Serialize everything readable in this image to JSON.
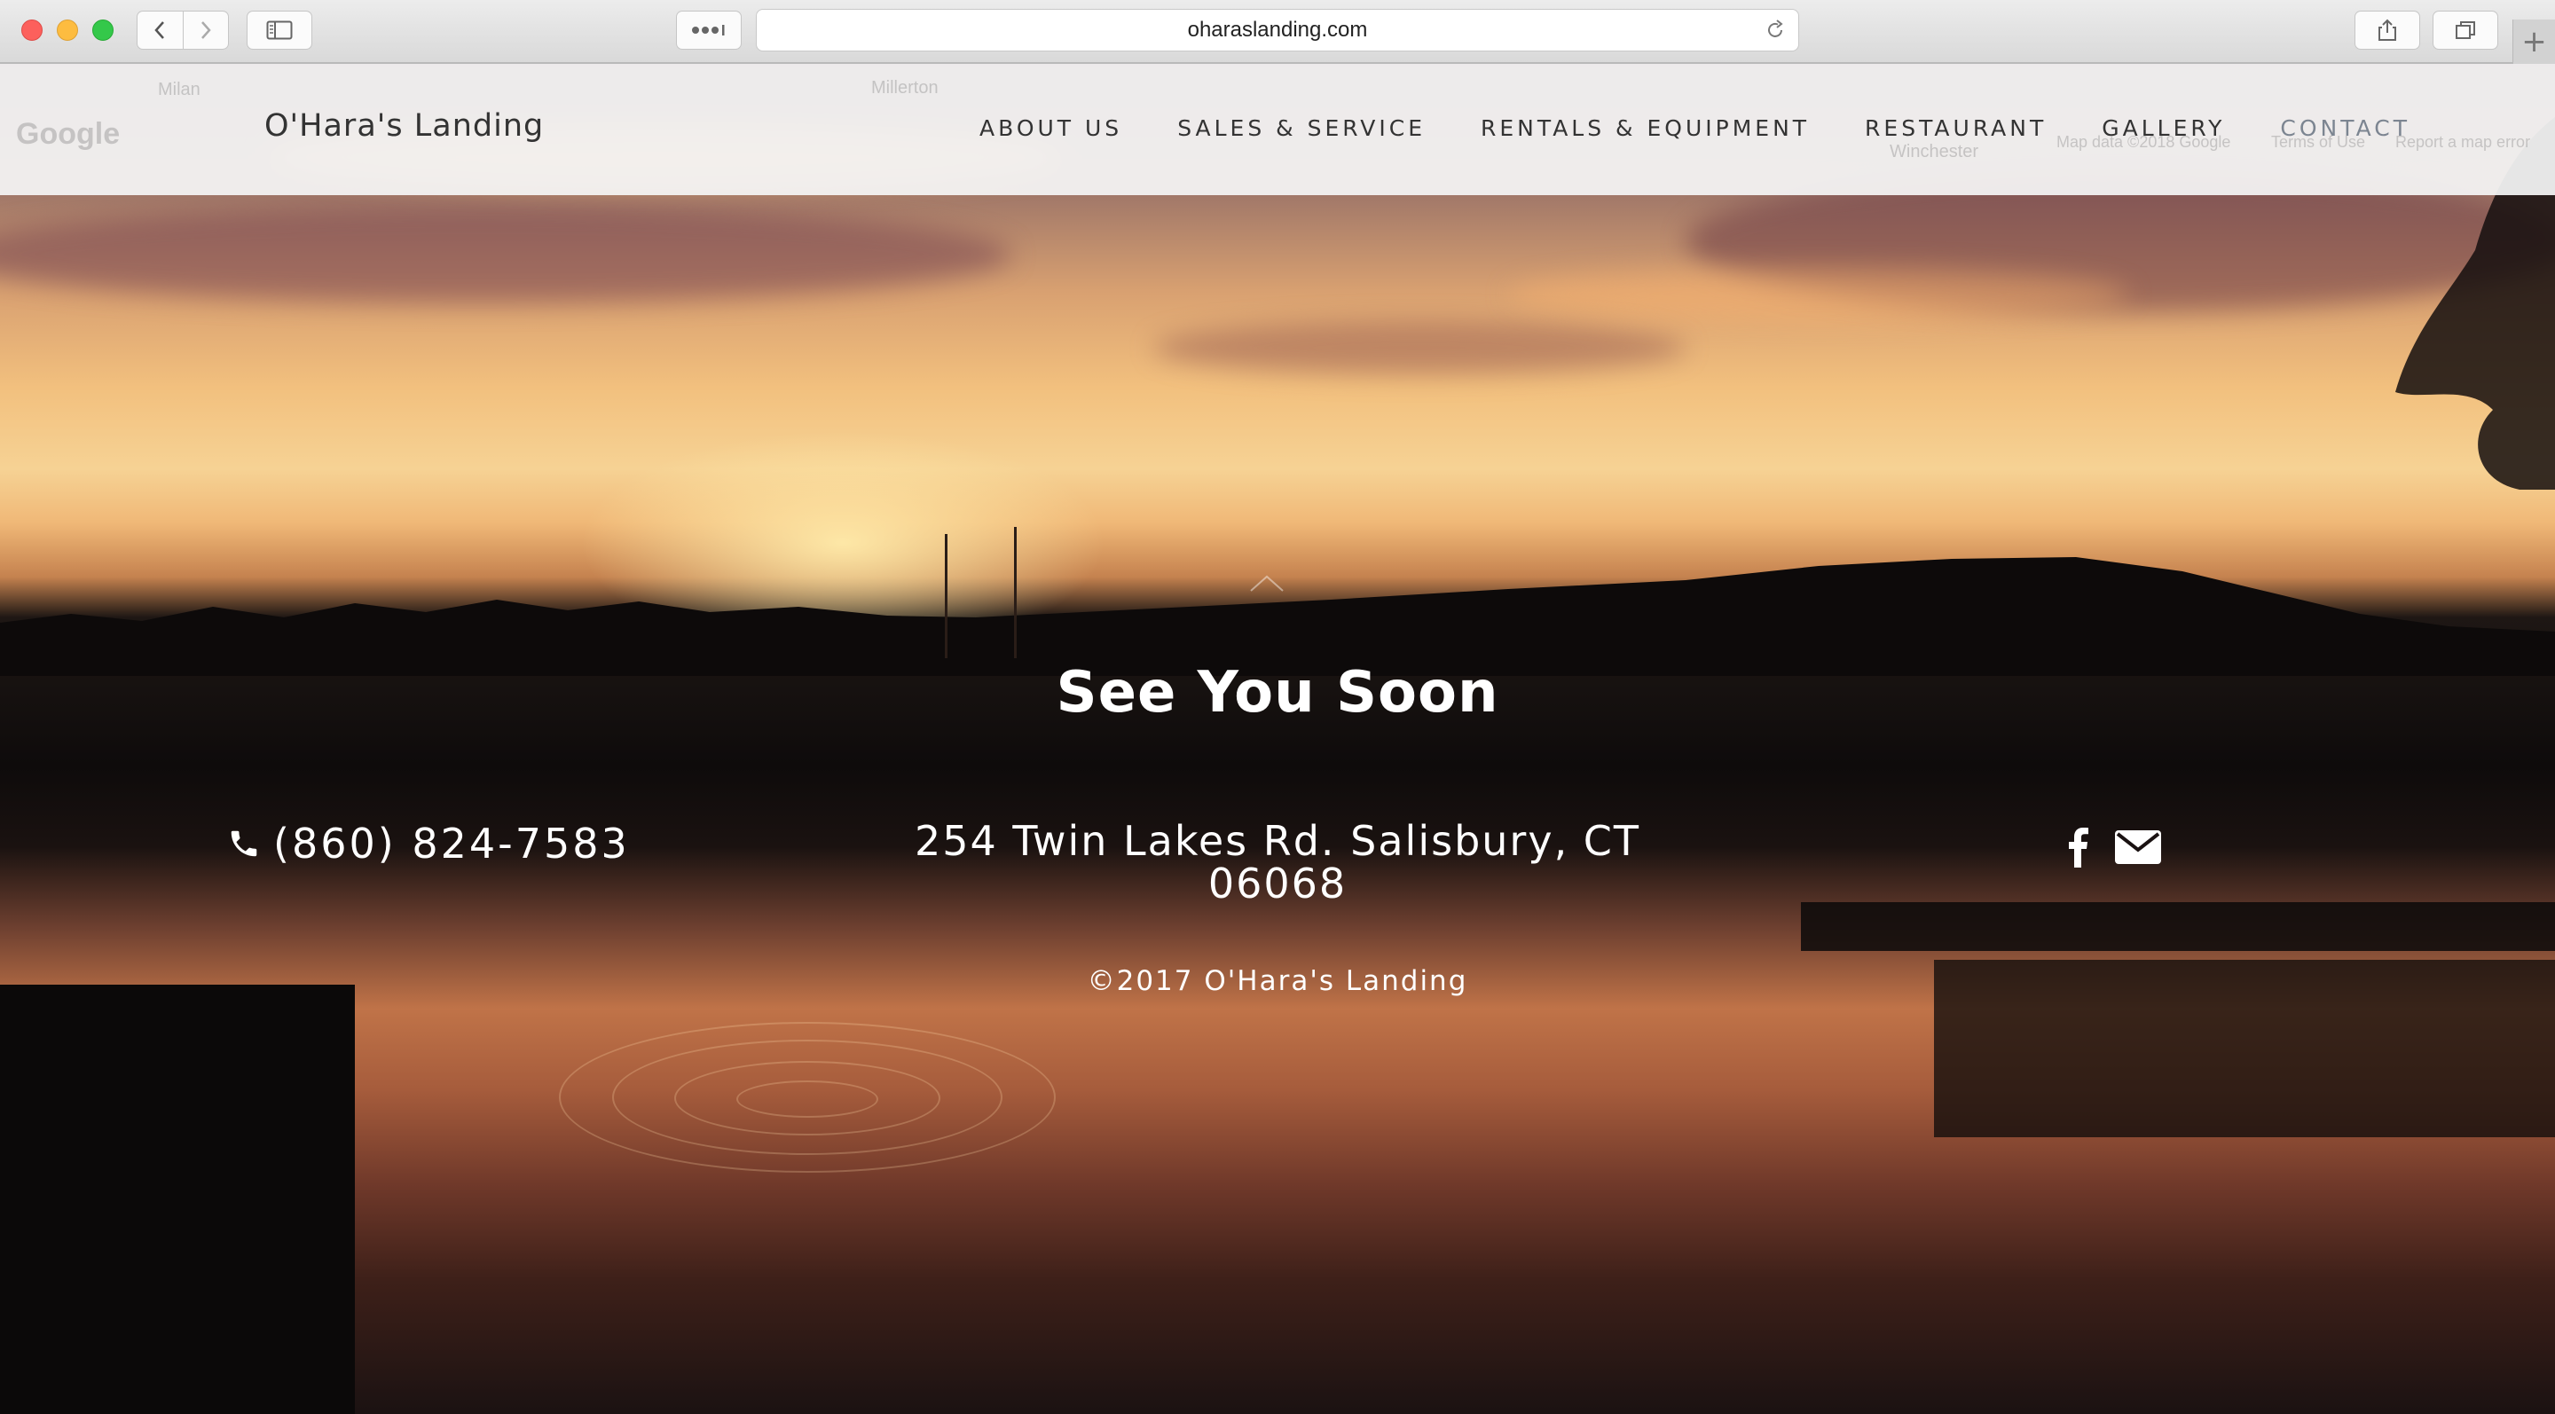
{
  "browser": {
    "url": "oharaslanding.com"
  },
  "map_ghost": {
    "labels": [
      "Milan",
      "Millerton",
      "Google",
      "Winchester",
      "Map data ©2018 Google",
      "Terms of Use",
      "Report a map error"
    ]
  },
  "site": {
    "logo": "O'Hara's Landing",
    "nav": [
      {
        "label": "ABOUT US"
      },
      {
        "label": "SALES & SERVICE"
      },
      {
        "label": "RENTALS & EQUIPMENT"
      },
      {
        "label": "RESTAURANT"
      },
      {
        "label": "GALLERY"
      },
      {
        "label": "CONTACT"
      }
    ],
    "active_nav": "CONTACT"
  },
  "footer": {
    "title": "See You Soon",
    "phone": "(860) 824-7583",
    "address": "254 Twin Lakes Rd. Salisbury, CT 06068",
    "copyright": "©2017 O'Hara's Landing",
    "social": [
      "facebook-icon",
      "email-icon"
    ]
  },
  "colors": {
    "nav_active": "#7c8591",
    "nav_text": "#333333"
  }
}
